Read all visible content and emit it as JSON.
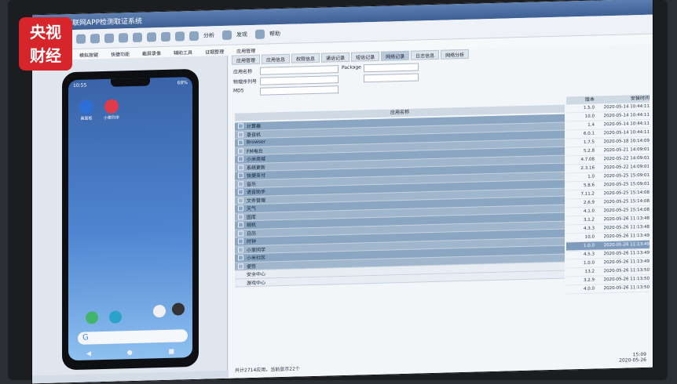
{
  "logo": {
    "line1": "央视",
    "line2": "财经"
  },
  "window": {
    "title": "移动互联网APP检测取证系统"
  },
  "toolbar": {
    "items": [
      "分析",
      "发现",
      "帮助"
    ]
  },
  "subbar": {
    "items": [
      "模拟按键",
      "快捷功能",
      "截屏录像",
      "辅助工具",
      "证据整理",
      "应用管理"
    ]
  },
  "tabs": [
    "应用管理",
    "应用信息",
    "权限信息",
    "通话记录",
    "短信记录",
    "网络记录",
    "日志信息",
    "网络分析"
  ],
  "form": {
    "app_name_label": "应用名称",
    "package_label": "Package",
    "device_label": "物理序列号",
    "md5_label": "MD5",
    "list_header": "应用名称"
  },
  "phone": {
    "time": "10:55",
    "battery": "68%",
    "apps": [
      "画面板",
      "小爱同学"
    ]
  },
  "apps": [
    {
      "name": "计算器",
      "selected": true
    },
    {
      "name": "录音机"
    },
    {
      "name": "Browser"
    },
    {
      "name": "FM电台"
    },
    {
      "name": "小米商城"
    },
    {
      "name": "系统更新"
    },
    {
      "name": "快捷支付"
    },
    {
      "name": "音乐"
    },
    {
      "name": "语音助手"
    },
    {
      "name": "文件管理"
    },
    {
      "name": "天气"
    },
    {
      "name": "图库"
    },
    {
      "name": "相机"
    },
    {
      "name": "日历"
    },
    {
      "name": "时钟"
    },
    {
      "name": "小爱同学"
    },
    {
      "name": "小米社区"
    },
    {
      "name": "便签"
    },
    {
      "name": "安全中心"
    },
    {
      "name": "游戏中心"
    }
  ],
  "table": {
    "headers": [
      "版本",
      "安装时间"
    ],
    "rows": [
      [
        "1.5.0",
        "2020-05-14 10:44:11"
      ],
      [
        "10.0",
        "2020-05-14 10:44:11"
      ],
      [
        "1.4",
        "2020-05-14 10:44:11"
      ],
      [
        "6.0.1",
        "2020-05-14 10:44:11"
      ],
      [
        "1.7.5",
        "2020-05-18 10:14:09"
      ],
      [
        "5.2.8",
        "2020-05-21 14:09:01"
      ],
      [
        "4.7.08",
        "2020-05-22 14:09:01"
      ],
      [
        "2.3.16",
        "2020-05-22 14:09:01"
      ],
      [
        "1.0",
        "2020-05-25 15:09:01"
      ],
      [
        "5.8.6",
        "2020-05-25 15:09:01"
      ],
      [
        "7.11.2",
        "2020-05-25 15:14:08"
      ],
      [
        "2.6.9",
        "2020-05-25 15:14:08"
      ],
      [
        "4.1.0",
        "2020-05-25 15:14:08"
      ],
      [
        "3.1.2",
        "2020-05-26 11:13:48"
      ],
      [
        "4.3.3",
        "2020-05-26 11:13:48"
      ],
      [
        "10.0",
        "2020-05-26 11:13:49"
      ],
      [
        "1.0.0",
        "2020-05-26 11:13:49"
      ],
      [
        "4.5.3",
        "2020-05-26 11:13:49"
      ],
      [
        "1.0.0",
        "2020-05-26 11:13:49"
      ],
      [
        "13.2",
        "2020-05-26 11:13:50"
      ],
      [
        "3.2.9",
        "2020-05-26 11:13:50"
      ],
      [
        "4.0.0",
        "2020-05-26 11:13:50"
      ]
    ]
  },
  "status": {
    "left": "共计2714应用，当前显示22个",
    "right_time": "15:09",
    "right_date": "2020-05-26"
  }
}
